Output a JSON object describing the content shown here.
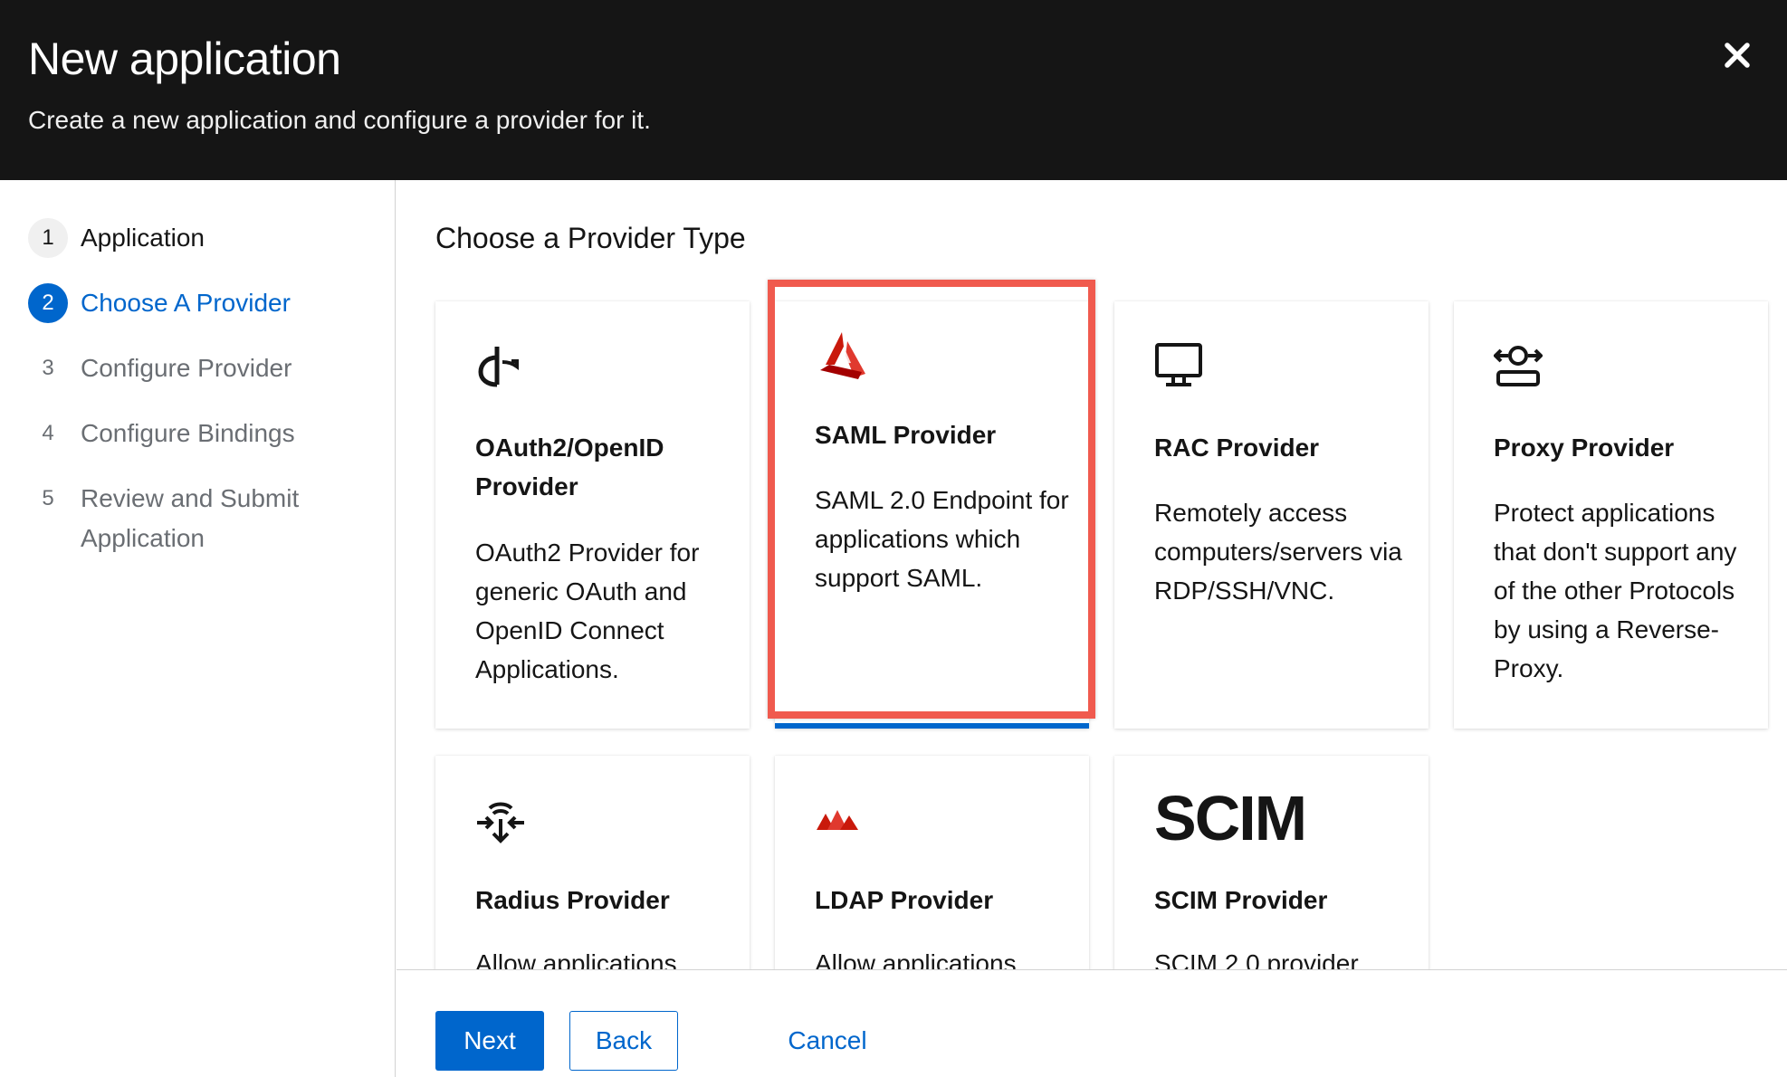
{
  "header": {
    "title": "New application",
    "subtitle": "Create a new application and configure a provider for it."
  },
  "steps": [
    {
      "num": "1",
      "label": "Application",
      "state": "done"
    },
    {
      "num": "2",
      "label": "Choose A Provider",
      "state": "current"
    },
    {
      "num": "3",
      "label": "Configure Provider",
      "state": "pending"
    },
    {
      "num": "4",
      "label": "Configure Bindings",
      "state": "pending"
    },
    {
      "num": "5",
      "label": "Review and Submit Application",
      "state": "pending"
    }
  ],
  "main": {
    "heading": "Choose a Provider Type"
  },
  "providers": [
    {
      "icon": "openid-icon",
      "title": "OAuth2/OpenID Provider",
      "description": "OAuth2 Provider for generic OAuth and OpenID Connect Applications."
    },
    {
      "icon": "saml-icon",
      "title": "SAML Provider",
      "description": "SAML 2.0 Endpoint for applications which support SAML.",
      "selected": true
    },
    {
      "icon": "monitor-icon",
      "title": "RAC Provider",
      "description": "Remotely access computers/servers via RDP/SSH/VNC."
    },
    {
      "icon": "proxy-icon",
      "title": "Proxy Provider",
      "description": "Protect applications that don't support any of the other Protocols by using a Reverse-Proxy."
    },
    {
      "icon": "radius-icon",
      "title": "Radius Provider",
      "description": "Allow applications"
    },
    {
      "icon": "ldap-icon",
      "title": "LDAP Provider",
      "description": "Allow applications"
    },
    {
      "icon": "scim-icon",
      "title": "SCIM Provider",
      "description": "SCIM 2.0 provider",
      "logo_text": "SCIM"
    }
  ],
  "footer": {
    "next": "Next",
    "back": "Back",
    "cancel": "Cancel"
  },
  "colors": {
    "accent": "#0066cc",
    "header_bg": "#151515",
    "highlight": "#f05a4e",
    "saml_red": "#c9190b"
  }
}
